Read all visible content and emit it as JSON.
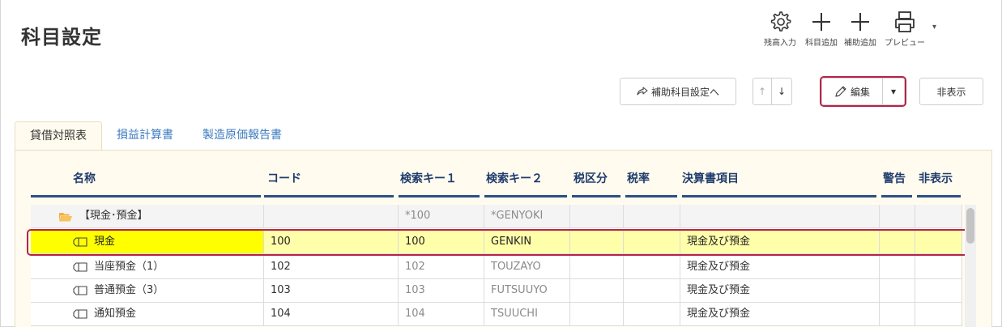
{
  "page": {
    "title": "科目設定"
  },
  "toolbar": {
    "zandaka_label": "残高入力",
    "kamoku_label": "科目追加",
    "hojo_label": "補助追加",
    "preview_label": "プレビュー",
    "more_glyph": "▾"
  },
  "actions": {
    "hojo_settei_label": "補助科目設定へ",
    "up_label": "↑",
    "down_label": "↓",
    "edit_label": "編集",
    "edit_dropdown_glyph": "▾",
    "hidden_label": "非表示"
  },
  "tabs": [
    {
      "label": "貸借対照表",
      "active": true
    },
    {
      "label": "損益計算書",
      "active": false
    },
    {
      "label": "製造原価報告書",
      "active": false
    }
  ],
  "columns": {
    "name": "名称",
    "code": "コード",
    "key1": "検索キー１",
    "key2": "検索キー２",
    "tax_class": "税区分",
    "tax_rate": "税率",
    "fs_item": "決算書項目",
    "warning": "警告",
    "hidden": "非表示"
  },
  "rows": [
    {
      "type": "group",
      "name": "【現金･預金】",
      "code": "",
      "key1": "*100",
      "key2": "*GENYOKI",
      "fs_item": ""
    },
    {
      "type": "item",
      "selected": true,
      "name": "現金",
      "code": "100",
      "key1": "100",
      "key2": "GENKIN",
      "fs_item": "現金及び預金"
    },
    {
      "type": "item",
      "name": "当座預金（1）",
      "code": "102",
      "key1": "102",
      "key2": "TOUZAYO",
      "fs_item": "現金及び預金"
    },
    {
      "type": "item",
      "name": "普通預金（3）",
      "code": "103",
      "key1": "103",
      "key2": "FUTSUUYO",
      "fs_item": "現金及び預金"
    },
    {
      "type": "item",
      "name": "通知預金",
      "code": "104",
      "key1": "104",
      "key2": "TSUUCHI",
      "fs_item": "現金及び預金"
    }
  ],
  "colors": {
    "accent": "#b5234a",
    "link": "#3b7bbf",
    "header": "#1f3c6e",
    "selected_row": "#ffffaa",
    "selected_name": "#ffff00",
    "panel": "#fffbee"
  }
}
